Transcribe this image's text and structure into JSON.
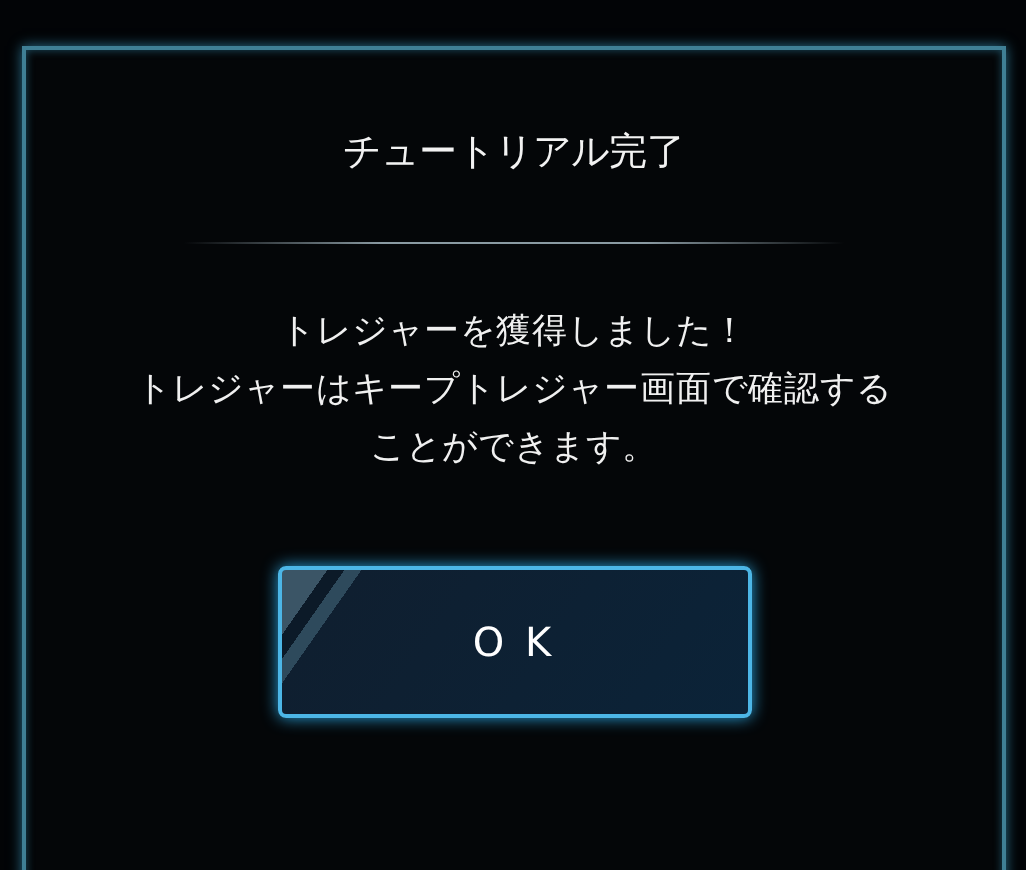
{
  "dialog": {
    "title": "チュートリアル完了",
    "message_lines": [
      "トレジャーを獲得しました！",
      "トレジャーはキープトレジャー画面で確認する",
      "ことができます。"
    ],
    "buttons": [
      "O K"
    ]
  }
}
